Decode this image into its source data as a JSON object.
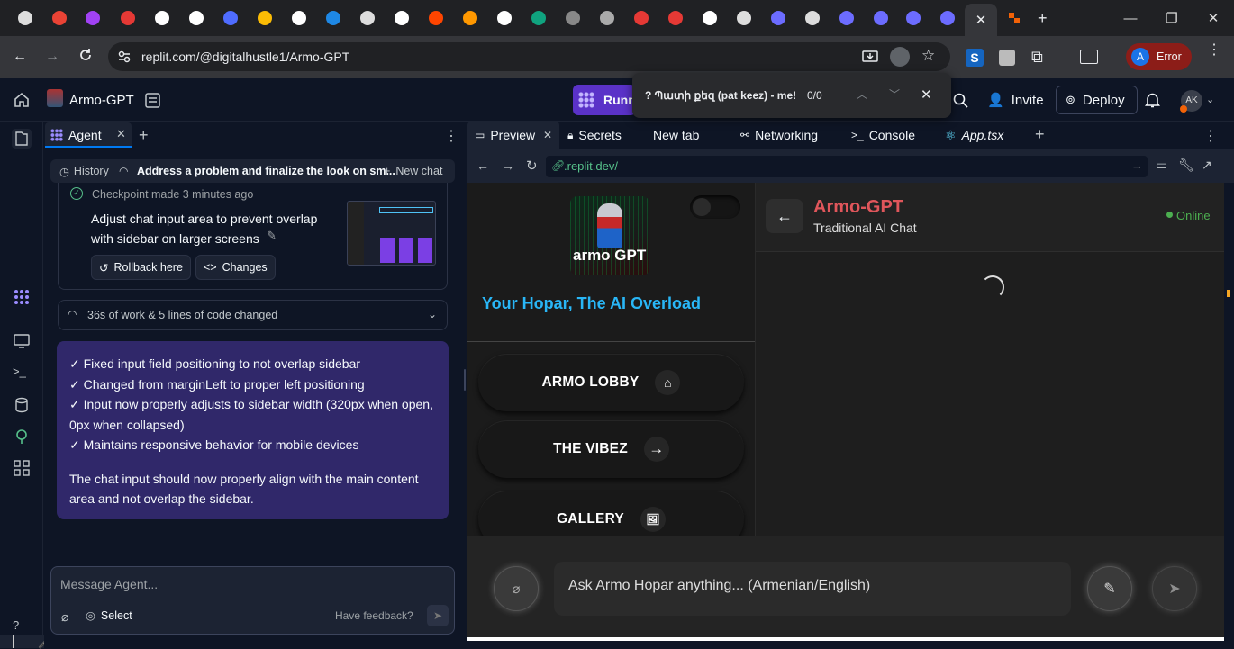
{
  "browser": {
    "url": "replit.com/@digitalhustle1/Armo-GPT",
    "profile_initial": "A",
    "profile_status": "Error",
    "tab_favicon_colors": [
      "#ddd",
      "#ea4335",
      "#a142f4",
      "#e53935",
      "#fff",
      "#fff",
      "#4f6cff",
      "#fbbc05",
      "#fff",
      "#1e88e5",
      "#ddd",
      "#fff",
      "#ff4500",
      "#ff9800",
      "#fff",
      "#10a37f",
      "#888",
      "#aaa",
      "#e53935",
      "#e53935",
      "#fff",
      "#ddd",
      "#6c6cff",
      "#ddd",
      "#6c6cff",
      "#6c6cff",
      "#6c6cff",
      "#6c6cff"
    ],
    "find": {
      "query": "? Պատի քեզ (pat keez) - me!",
      "count": "0/0"
    }
  },
  "header": {
    "project": "Armo-GPT",
    "run_label": "Runn",
    "invite": "Invite",
    "deploy": "Deploy",
    "avatar": "AK"
  },
  "agent": {
    "tab_label": "Agent",
    "history": "History",
    "thread_title": "Address a problem and finalize the look on sm...",
    "new_chat": "New chat",
    "checkpoint_time": "Checkpoint made 3 minutes ago",
    "checkpoint_title": "Adjust chat input area to prevent overlap with sidebar on larger screens",
    "rollback": "Rollback here",
    "changes": "Changes",
    "work_summary": "36s of work & 5 lines of code changed",
    "message_lines": [
      "✓ Fixed input field positioning to not overlap sidebar",
      "✓ Changed from marginLeft to proper left positioning",
      "✓ Input now properly adjusts to sidebar width (320px when open, 0px when collapsed)",
      "✓ Maintains responsive behavior for mobile devices"
    ],
    "message_footer": "The chat input should now properly align with the main content area and not overlap the sidebar.",
    "composer_placeholder": "Message Agent...",
    "select_label": "Select",
    "feedback": "Have feedback?"
  },
  "preview": {
    "tabs": [
      "Preview",
      "Secrets",
      "New tab",
      "Networking",
      "Console",
      "App.tsx"
    ],
    "url": ".replit.dev/",
    "app": {
      "logo_text": "armo GPT",
      "tagline": "Your Hopar, The AI Overload",
      "nav": [
        "ARMO LOBBY",
        "THE VIBEZ",
        "GALLERY"
      ],
      "chat_title": "Armo-GPT",
      "chat_subtitle": "Traditional AI Chat",
      "status": "Online",
      "input_placeholder": "Ask Armo Hopar anything... (Armenian/English)"
    }
  },
  "colors": {
    "accent_blue": "#0079f2",
    "tagline": "#29b6f6",
    "chat_title": "#e0565b",
    "online": "#4caf50",
    "run_purple": "#5a32c8"
  }
}
